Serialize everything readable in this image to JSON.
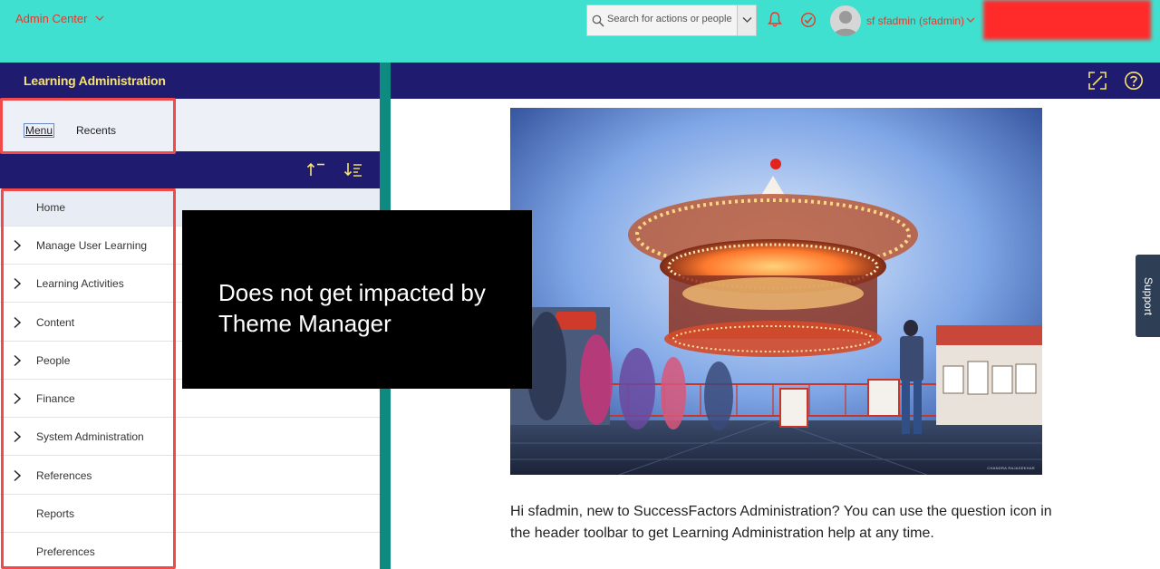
{
  "shell": {
    "app_title": "Admin Center",
    "search_placeholder": "Search for actions or people",
    "user_name": "sf sfadmin (sfadmin)"
  },
  "left_panel": {
    "title": "Learning Administration",
    "tabs": [
      {
        "label": "Menu",
        "active": true
      },
      {
        "label": "Recents",
        "active": false
      }
    ],
    "menu_items": [
      {
        "label": "Home",
        "expandable": false
      },
      {
        "label": "Manage User Learning",
        "expandable": true
      },
      {
        "label": "Learning Activities",
        "expandable": true
      },
      {
        "label": "Content",
        "expandable": true
      },
      {
        "label": "People",
        "expandable": true
      },
      {
        "label": "Finance",
        "expandable": true
      },
      {
        "label": "System Administration",
        "expandable": true
      },
      {
        "label": "References",
        "expandable": true
      },
      {
        "label": "Reports",
        "expandable": false
      },
      {
        "label": "Preferences",
        "expandable": false
      }
    ]
  },
  "main": {
    "intro_text": "Hi sfadmin, new to SuccessFactors Administration? You can use the question icon in the header toolbar to get Learning Administration help at any time.",
    "photo_credit": "CHANDRA RAJASEKHAR"
  },
  "support_label": "Support",
  "annotation": {
    "callout_text": "Does not get impacted by Theme Manager"
  },
  "colors": {
    "shell_bg": "#40e0d0",
    "header_bg": "#1f1b6f",
    "header_text": "#f7e36b",
    "accent_red": "#e8372b",
    "divider": "#0f8a80",
    "annotation_red": "#f24a4a"
  }
}
